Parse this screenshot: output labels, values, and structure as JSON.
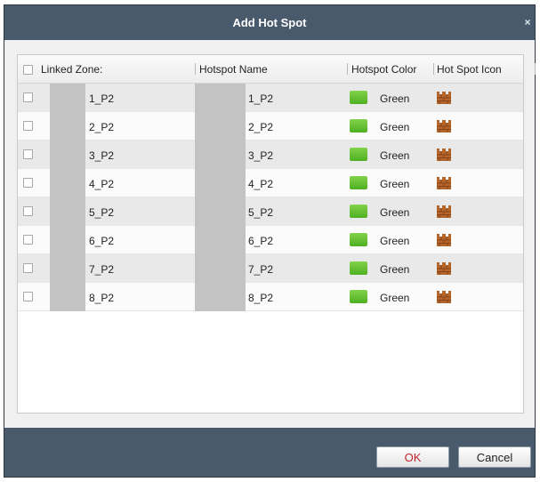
{
  "dialog": {
    "title": "Add Hot Spot",
    "close_glyph": "×"
  },
  "table": {
    "columns": {
      "linked_zone": "Linked Zone:",
      "hotspot_name": "Hotspot Name",
      "hotspot_color": "Hotspot Color",
      "hot_spot_icon": "Hot Spot Icon"
    },
    "rows": [
      {
        "zone": "1_P2",
        "name": "1_P2",
        "color": "Green",
        "color_hex": "#5cbf2a",
        "icon": "brick-wall-icon",
        "checked": false
      },
      {
        "zone": "2_P2",
        "name": "2_P2",
        "color": "Green",
        "color_hex": "#5cbf2a",
        "icon": "brick-wall-icon",
        "checked": false
      },
      {
        "zone": "3_P2",
        "name": "3_P2",
        "color": "Green",
        "color_hex": "#5cbf2a",
        "icon": "brick-wall-icon",
        "checked": false
      },
      {
        "zone": "4_P2",
        "name": "4_P2",
        "color": "Green",
        "color_hex": "#5cbf2a",
        "icon": "brick-wall-icon",
        "checked": false
      },
      {
        "zone": "5_P2",
        "name": "5_P2",
        "color": "Green",
        "color_hex": "#5cbf2a",
        "icon": "brick-wall-icon",
        "checked": false
      },
      {
        "zone": "6_P2",
        "name": "6_P2",
        "color": "Green",
        "color_hex": "#5cbf2a",
        "icon": "brick-wall-icon",
        "checked": false
      },
      {
        "zone": "7_P2",
        "name": "7_P2",
        "color": "Green",
        "color_hex": "#5cbf2a",
        "icon": "brick-wall-icon",
        "checked": false
      },
      {
        "zone": "8_P2",
        "name": "8_P2",
        "color": "Green",
        "color_hex": "#5cbf2a",
        "icon": "brick-wall-icon",
        "checked": false
      }
    ]
  },
  "buttons": {
    "ok": "OK",
    "cancel": "Cancel"
  },
  "colors": {
    "titlebar": "#4a5a6d",
    "ok_text": "#c0262d",
    "swatch_green": "#5cbf2a",
    "wall_icon": "#b5652a"
  }
}
